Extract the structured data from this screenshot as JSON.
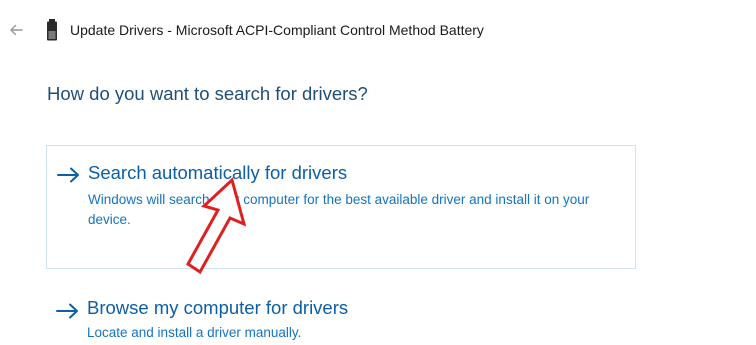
{
  "header": {
    "title": "Update Drivers - Microsoft ACPI-Compliant Control Method Battery",
    "back_icon": "back-arrow-icon",
    "device_icon": "battery-device-icon"
  },
  "main": {
    "question": "How do you want to search for drivers?",
    "options": [
      {
        "title": "Search automatically for drivers",
        "description": "Windows will search your computer for the best available driver and install it on your device.",
        "icon": "arrow-right-icon",
        "highlighted": true
      },
      {
        "title": "Browse my computer for drivers",
        "description": "Locate and install a driver manually.",
        "icon": "arrow-right-icon",
        "highlighted": false
      }
    ]
  },
  "annotation": {
    "icon": "red-pointer-arrow-icon",
    "color": "#e02020"
  },
  "colors": {
    "accent": "#0a5fa8",
    "heading": "#1f4e79",
    "description": "#1573c4",
    "highlight_border": "#cfe3f1"
  }
}
